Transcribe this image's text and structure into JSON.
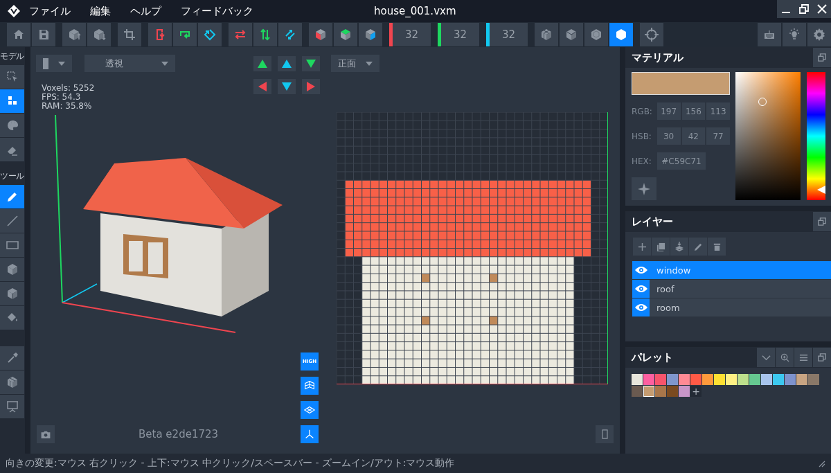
{
  "app": {
    "menus": [
      "ファイル",
      "編集",
      "ヘルプ",
      "フィードバック"
    ],
    "title": "house_001.vxm"
  },
  "toolbar": {
    "axes": [
      {
        "value": "32",
        "color": "#f0454f"
      },
      {
        "value": "32",
        "color": "#1ed760"
      },
      {
        "value": "32",
        "color": "#12c8f0"
      }
    ],
    "view_modes": [
      {
        "selected": false
      },
      {
        "selected": false
      },
      {
        "selected": false
      },
      {
        "selected": true
      }
    ]
  },
  "sidebar": {
    "sections": [
      {
        "label": "モデル",
        "tools": [
          {
            "selected": false
          },
          {
            "selected": true
          },
          {
            "selected": false
          },
          {
            "selected": false
          }
        ]
      },
      {
        "label": "ツール",
        "tools": [
          {
            "selected": true
          },
          {
            "selected": false
          },
          {
            "selected": false
          },
          {
            "selected": false
          },
          {
            "selected": false
          },
          {
            "selected": false
          }
        ]
      },
      {
        "tools": [
          {
            "selected": false
          },
          {
            "selected": false
          },
          {
            "selected": false
          }
        ]
      }
    ]
  },
  "viewport": {
    "projection": "透視",
    "view": "正面",
    "stats": [
      "Voxels: 5252",
      "FPS: 54.3",
      "RAM: 35.8%"
    ],
    "quality": "HIGH",
    "version": "Beta e2de1723"
  },
  "material": {
    "title": "マテリアル",
    "rgb_label": "RGB:",
    "rgb": [
      "197",
      "156",
      "113"
    ],
    "hsb_label": "HSB:",
    "hsb": [
      "30",
      "42",
      "77"
    ],
    "hex_label": "HEX:",
    "hex": "#C59C71",
    "hue": {
      "level": 0.08
    }
  },
  "layers": {
    "title": "レイヤー",
    "items": [
      {
        "name": "window",
        "selected": true,
        "visible": true
      },
      {
        "name": "roof",
        "selected": false,
        "visible": true
      },
      {
        "name": "room",
        "selected": false,
        "visible": true
      }
    ]
  },
  "palette": {
    "title": "パレット",
    "add": "+",
    "colors": [
      {
        "color": "#e8e6dc",
        "selected": false
      },
      {
        "color": "#ff5fa0",
        "selected": false
      },
      {
        "color": "#f7546c",
        "selected": false
      },
      {
        "color": "#7f96cc",
        "selected": false
      },
      {
        "color": "#ff8a94",
        "selected": false
      },
      {
        "color": "#ff5a46",
        "selected": false
      },
      {
        "color": "#ff9a3c",
        "selected": false
      },
      {
        "color": "#ffe033",
        "selected": false
      },
      {
        "color": "#fff084",
        "selected": false
      },
      {
        "color": "#bee08c",
        "selected": false
      },
      {
        "color": "#66c890",
        "selected": false
      },
      {
        "color": "#a8c4ec",
        "selected": false
      },
      {
        "color": "#3cc8f0",
        "selected": false
      },
      {
        "color": "#7e92cc",
        "selected": false
      },
      {
        "color": "#c8a482",
        "selected": false
      },
      {
        "color": "#8a7868",
        "selected": false
      },
      {
        "color": "#6a5a50",
        "selected": false
      },
      {
        "color": "#c59c71",
        "selected": true
      },
      {
        "color": "#a8764a",
        "selected": false
      },
      {
        "color": "#7a4a20",
        "selected": false
      },
      {
        "color": "#c896c8",
        "selected": false
      }
    ]
  },
  "status_bar": "向きの変更:マウス 右クリック - 上下:マウス 中クリック/スペースバー - ズームイン/アウト:マウス動作"
}
